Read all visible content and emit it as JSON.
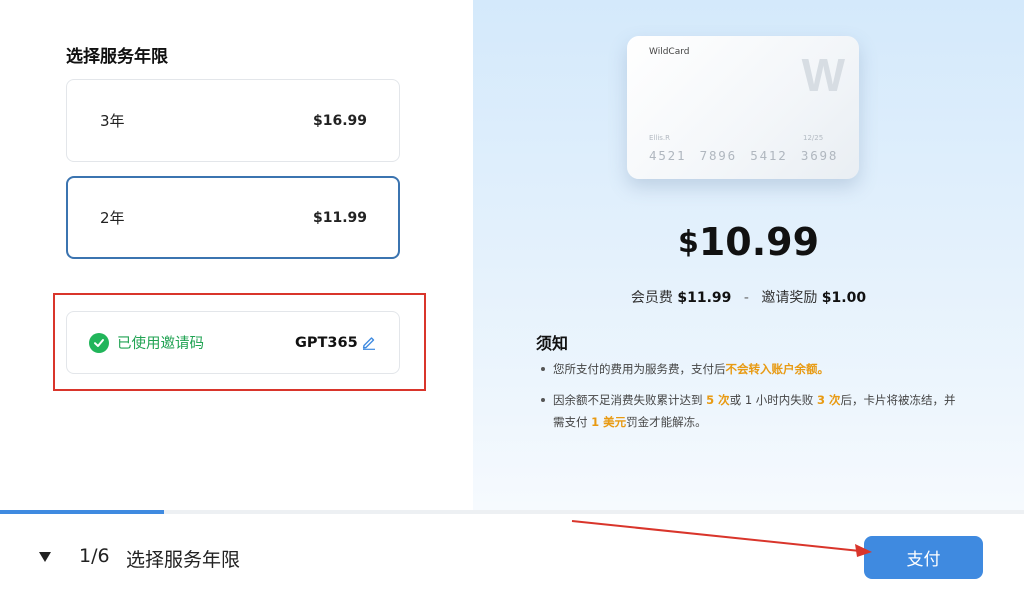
{
  "left": {
    "section_title": "选择服务年限",
    "plans": [
      {
        "label": "3年",
        "price": "$16.99"
      },
      {
        "label": "2年",
        "price": "$11.99"
      }
    ],
    "invite": {
      "status": "已使用邀请码",
      "code": "GPT365"
    }
  },
  "card": {
    "brand": "WildCard",
    "logo_letter": "W",
    "holder": "Ellis.R",
    "expiry": "12/25",
    "number": "4521 7896 5412 3698"
  },
  "price": {
    "currency": "$",
    "amount": "10.99",
    "fee_label": "会员费",
    "fee": "$11.99",
    "separator": "-",
    "reward_label": "邀请奖励",
    "reward": "$1.00"
  },
  "notice": {
    "title": "须知",
    "item1": {
      "a": "您所支付的费用为服务费，支付后",
      "b": "不会转入账户余额。"
    },
    "item2": {
      "a": "因余额不足消费失败累计达到 ",
      "b": "5 次",
      "c": "或 1 小时内失败 ",
      "d": "3 次",
      "e": "后，卡片将被冻结，并需支付 ",
      "f": "1 美元",
      "g": "罚金才能解冻。"
    }
  },
  "footer": {
    "step": "1/6",
    "step_title": "选择服务年限",
    "pay_label": "支付",
    "progress_fraction": 0.16
  },
  "colors": {
    "accent": "#3f8ae0",
    "success": "#21b55a",
    "highlight": "#e89a12",
    "annotation": "#d9352b"
  }
}
